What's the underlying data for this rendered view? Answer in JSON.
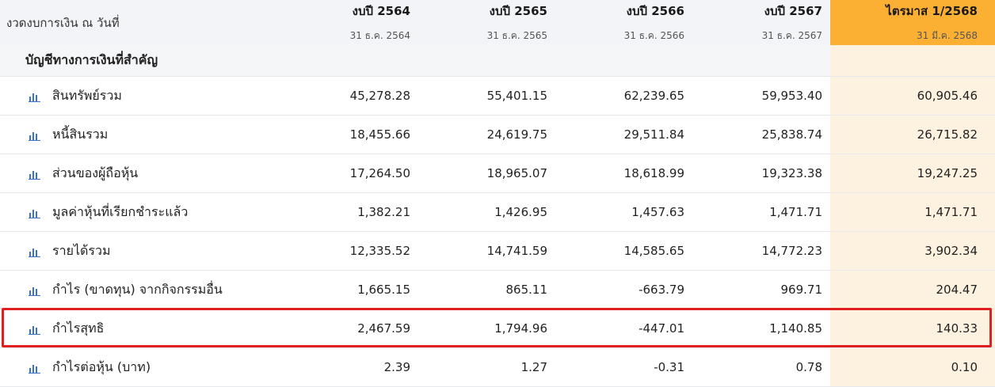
{
  "header": {
    "label": "งวดงบการเงิน ณ วันที่",
    "columns": [
      {
        "title": "งบปี 2564",
        "date": "31 ธ.ค. 2564"
      },
      {
        "title": "งบปี 2565",
        "date": "31 ธ.ค. 2565"
      },
      {
        "title": "งบปี 2566",
        "date": "31 ธ.ค. 2566"
      },
      {
        "title": "งบปี 2567",
        "date": "31 ธ.ค. 2567"
      },
      {
        "title": "ไตรมาส 1/2568",
        "date": "31 มี.ค. 2568"
      }
    ]
  },
  "section_title": "บัญชีทางการเงินที่สำคัญ",
  "rows": [
    {
      "label": "สินทรัพย์รวม",
      "values": [
        "45,278.28",
        "55,401.15",
        "62,239.65",
        "59,953.40",
        "60,905.46"
      ]
    },
    {
      "label": "หนี้สินรวม",
      "values": [
        "18,455.66",
        "24,619.75",
        "29,511.84",
        "25,838.74",
        "26,715.82"
      ]
    },
    {
      "label": "ส่วนของผู้ถือหุ้น",
      "values": [
        "17,264.50",
        "18,965.07",
        "18,618.99",
        "19,323.38",
        "19,247.25"
      ]
    },
    {
      "label": "มูลค่าหุ้นที่เรียกชำระแล้ว",
      "values": [
        "1,382.21",
        "1,426.95",
        "1,457.63",
        "1,471.71",
        "1,471.71"
      ]
    },
    {
      "label": "รายได้รวม",
      "values": [
        "12,335.52",
        "14,741.59",
        "14,585.65",
        "14,772.23",
        "3,902.34"
      ]
    },
    {
      "label": "กำไร (ขาดทุน) จากกิจกรรมอื่น",
      "values": [
        "1,665.15",
        "865.11",
        "-663.79",
        "969.71",
        "204.47"
      ]
    },
    {
      "label": "กำไรสุทธิ",
      "values": [
        "2,467.59",
        "1,794.96",
        "-447.01",
        "1,140.85",
        "140.33"
      ]
    },
    {
      "label": "กำไรต่อหุ้น (บาท)",
      "values": [
        "2.39",
        "1.27",
        "-0.31",
        "0.78",
        "0.10"
      ]
    }
  ],
  "colors": {
    "accent_header": "#fbb034",
    "accent_column": "#fdf1df",
    "highlight_border": "#e02020",
    "icon": "#3b6fd8"
  },
  "icon_name": "bar-chart-icon"
}
